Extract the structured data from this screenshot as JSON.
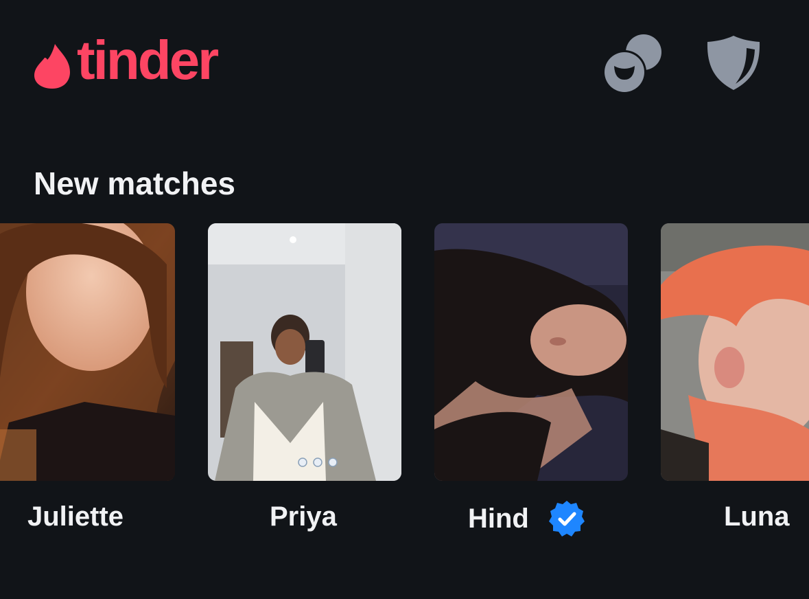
{
  "app": {
    "brand": "tinder"
  },
  "header": {
    "icons": [
      "matches-chat-icon",
      "shield-safety-icon"
    ]
  },
  "section": {
    "title": "New matches"
  },
  "matches": [
    {
      "name": "Juliette",
      "verified": false
    },
    {
      "name": "Priya",
      "verified": false
    },
    {
      "name": "Hind",
      "verified": true
    },
    {
      "name": "Luna",
      "verified": false
    }
  ],
  "colors": {
    "brand": "#fd4563",
    "background": "#111418",
    "icon": "#8e96a3",
    "verified": "#1e86ff",
    "text": "#f1f2f4"
  }
}
